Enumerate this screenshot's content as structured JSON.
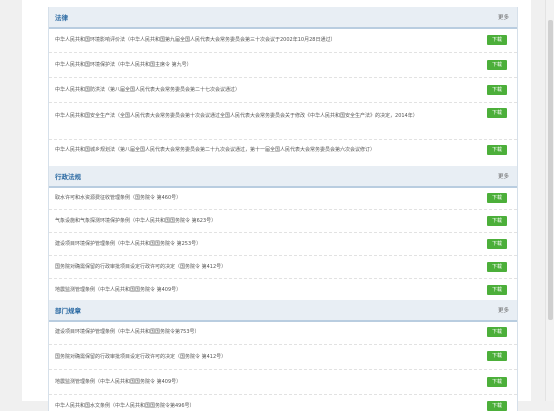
{
  "sections": [
    {
      "title": "法律",
      "more": "更多",
      "items": [
        "中华人民共和国环境影响评价法（中华人民共和国第九届全国人民代表大会常务委员会第三十次会议于2002年10月28日通过）",
        "中华人民共和国环境保护法（中华人民共和国主席令 第九号）",
        "中华人民共和国防洪法（第八届全国人民代表大会常务委员会第二十七次会议通过）",
        "中华人民共和国安全生产法（全国人民代表大会常务委员会第十次会议通过全国人民代表大会常务委员会关于修改《中华人民共和国安全生产法》的决定，2014年）",
        "中华人民共和国城乡规划法（第八届全国人民代表大会常务委员会第二十九次会议通过，第十一届全国人民代表大会常务委员会第六次会议修订）"
      ]
    },
    {
      "title": "行政法规",
      "more": "更多",
      "items": [
        "取水许可和水资源费征收管理条例（国务院令 第460号）",
        "气象设施和气象探测环境保护条例（中华人民共和国国务院令 第623号）",
        "建设项目环境保护管理条例（中华人民共和国国务院令 第253号）",
        "国务院对确需保留的行政审批项目设定行政许可的决定（国务院令 第412号）",
        "地震监测管理条例（中华人民共和国国务院令 第409号）"
      ]
    },
    {
      "title": "部门规章",
      "more": "更多",
      "items": [
        "建设项目环境保护管理条例（中华人民共和国国务院令第753号）",
        "国务院对确需保留的行政审批项目设定行政许可的决定（国务院令 第412号）",
        "地震监测管理条例（中华人民共和国国务院令 第409号）",
        "中华人民共和国水文条例（中华人民共和国国务院令第496号）"
      ]
    }
  ],
  "download_label": "下载"
}
